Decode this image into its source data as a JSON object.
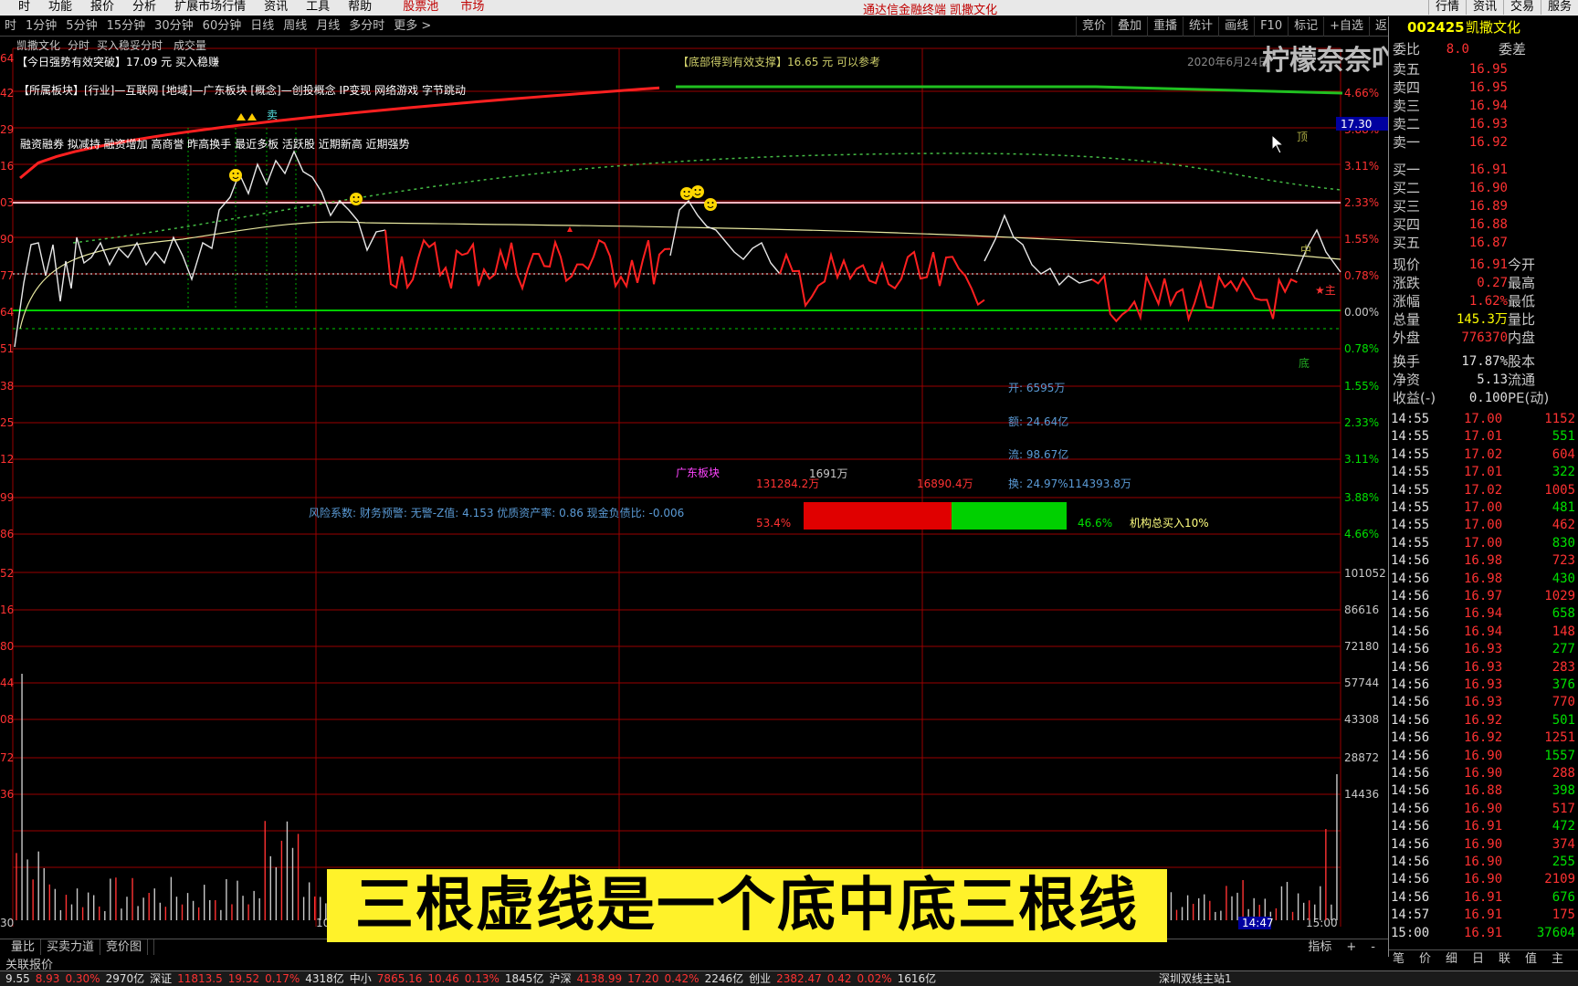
{
  "menu": {
    "items": [
      "时",
      "功能",
      "报价",
      "分析",
      "扩展市场行情",
      "资讯",
      "工具",
      "帮助"
    ],
    "pool": "股票池",
    "market": "市场",
    "center_title": "通达信金融终端  凯撒文化",
    "right": [
      "行情",
      "资讯",
      "交易",
      "服务"
    ]
  },
  "periods": [
    "时",
    "1分钟",
    "5分钟",
    "15分钟",
    "30分钟",
    "60分钟",
    "日线",
    "周线",
    "月线",
    "多分时",
    "更多 >"
  ],
  "toolbar": [
    "竞价",
    "叠加",
    "重播",
    "统计",
    "画线",
    "F10",
    "标记",
    "+自选",
    "返回"
  ],
  "chart_header": {
    "name": "凯撒文化",
    "mode": "分时",
    "buy_text": "买入稳妥分时",
    "vol_label": "成交量"
  },
  "annotations": {
    "strong_break": "【今日强势有效突破】17.09 元 买入稳赚",
    "bottom_support": "【底部得到有效支撑】16.65 元 可以参考",
    "date_text": "2020年6月24日",
    "sector": "【所属板块】[行业]—互联网 [地域]—广东板块 [概念]—创投概念 IP变现 网络游戏 字节跳动",
    "tags": "融资融券 拟减持 融资增加 高商誉 昨高换手 最近多板 活跃股 近期新高 近期强势",
    "top_mark": "顶",
    "mid_mark": "中",
    "bottom_mark": "底",
    "sell_mark": "卖",
    "main_mark": "★主",
    "price_marker": "17.30",
    "risk": "风险系数: 财务预警: 无警-Z值: 4.153 优质资产率: 0.86 现金负债比: -0.006",
    "sector_label": "广东板块",
    "open_amt": "开: 6595万",
    "amount": "额: 24.64亿",
    "flow": "流: 98.67亿",
    "turnover": "换: 24.97%114393.8万",
    "buy_amt": "131284.2万",
    "vol_mid": "1691万",
    "sell_amt": "16890.4万",
    "buy_pct": "53.4%",
    "sell_pct": "46.6%",
    "inst": "机构总买入10%",
    "watermark": "柠檬奈奈吖",
    "time_cursor": "14:47"
  },
  "axis": {
    "left_price": [
      "64",
      "42",
      "29",
      "16",
      "03",
      "90",
      "77",
      "64",
      "51",
      "38",
      "25",
      "12",
      "99",
      "86"
    ],
    "right_pct": [
      "4.66%",
      "3.88%",
      "3.11%",
      "2.33%",
      "1.55%",
      "0.78%",
      "0.00%",
      "0.78%",
      "1.55%",
      "2.33%",
      "3.11%",
      "3.88%",
      "4.66%"
    ],
    "left_vol": [
      "52",
      "16",
      "80",
      "44",
      "08",
      "72",
      "36"
    ],
    "right_vol": [
      "101052",
      "86616",
      "72180",
      "57744",
      "43308",
      "28872",
      "14436"
    ],
    "x_start": "30",
    "x_mid": "10",
    "x_end": "15:00"
  },
  "quote": {
    "code": "002425",
    "name": "凯撒文化",
    "weibi_label": "委比",
    "weibi": "8.0",
    "weicha_label": "委差",
    "asks": [
      {
        "label": "卖五",
        "price": "16.95"
      },
      {
        "label": "卖四",
        "price": "16.95"
      },
      {
        "label": "卖三",
        "price": "16.94"
      },
      {
        "label": "卖二",
        "price": "16.93"
      },
      {
        "label": "卖一",
        "price": "16.92"
      }
    ],
    "bids": [
      {
        "label": "买一",
        "price": "16.91"
      },
      {
        "label": "买二",
        "price": "16.90"
      },
      {
        "label": "买三",
        "price": "16.89"
      },
      {
        "label": "买四",
        "price": "16.88"
      },
      {
        "label": "买五",
        "price": "16.87"
      }
    ],
    "stats": [
      {
        "label": "现价",
        "value": "16.91",
        "label2": "今开",
        "color": "red"
      },
      {
        "label": "涨跌",
        "value": "0.27",
        "label2": "最高",
        "color": "red"
      },
      {
        "label": "涨幅",
        "value": "1.62%",
        "label2": "最低",
        "color": "red"
      },
      {
        "label": "总量",
        "value": "145.3万",
        "label2": "量比",
        "color": "yel"
      },
      {
        "label": "外盘",
        "value": "776370",
        "label2": "内盘",
        "color": "red"
      }
    ],
    "stats2": [
      {
        "label": "换手",
        "value": "17.87%",
        "label2": "股本"
      },
      {
        "label": "净资",
        "value": "5.13",
        "label2": "流通"
      },
      {
        "label": "收益(-)",
        "value": "0.100",
        "label2": "PE(动)"
      }
    ],
    "ticks": [
      {
        "t": "14:55",
        "p": "17.00",
        "v": "1152"
      },
      {
        "t": "14:55",
        "p": "17.01",
        "v": "551"
      },
      {
        "t": "14:55",
        "p": "17.02",
        "v": "604"
      },
      {
        "t": "14:55",
        "p": "17.01",
        "v": "322"
      },
      {
        "t": "14:55",
        "p": "17.02",
        "v": "1005"
      },
      {
        "t": "14:55",
        "p": "17.00",
        "v": "481"
      },
      {
        "t": "14:55",
        "p": "17.00",
        "v": "462"
      },
      {
        "t": "14:55",
        "p": "17.00",
        "v": "830"
      },
      {
        "t": "14:56",
        "p": "16.98",
        "v": "723"
      },
      {
        "t": "14:56",
        "p": "16.98",
        "v": "430"
      },
      {
        "t": "14:56",
        "p": "16.97",
        "v": "1029"
      },
      {
        "t": "14:56",
        "p": "16.94",
        "v": "658"
      },
      {
        "t": "14:56",
        "p": "16.94",
        "v": "148"
      },
      {
        "t": "14:56",
        "p": "16.93",
        "v": "277"
      },
      {
        "t": "14:56",
        "p": "16.93",
        "v": "283"
      },
      {
        "t": "14:56",
        "p": "16.93",
        "v": "376"
      },
      {
        "t": "14:56",
        "p": "16.93",
        "v": "770"
      },
      {
        "t": "14:56",
        "p": "16.92",
        "v": "501"
      },
      {
        "t": "14:56",
        "p": "16.92",
        "v": "1251"
      },
      {
        "t": "14:56",
        "p": "16.90",
        "v": "1557"
      },
      {
        "t": "14:56",
        "p": "16.90",
        "v": "288"
      },
      {
        "t": "14:56",
        "p": "16.88",
        "v": "398"
      },
      {
        "t": "14:56",
        "p": "16.90",
        "v": "517"
      },
      {
        "t": "14:56",
        "p": "16.91",
        "v": "472"
      },
      {
        "t": "14:56",
        "p": "16.90",
        "v": "374"
      },
      {
        "t": "14:56",
        "p": "16.90",
        "v": "255"
      },
      {
        "t": "14:56",
        "p": "16.90",
        "v": "2109"
      },
      {
        "t": "14:56",
        "p": "16.91",
        "v": "676"
      },
      {
        "t": "14:57",
        "p": "16.91",
        "v": "175"
      },
      {
        "t": "15:00",
        "p": "16.91",
        "v": "37604"
      }
    ],
    "bottom_tabs": [
      "笔",
      "价",
      "细",
      "日",
      "联",
      "值",
      "主"
    ]
  },
  "bottom_tabs": [
    "量比",
    "买卖力道",
    "竞价图"
  ],
  "bottom_right": [
    "指标",
    "+",
    "-"
  ],
  "linked_quote": "关联报价",
  "status": [
    {
      "text": "9.55",
      "c": "wht"
    },
    {
      "text": "8.93",
      "c": "red"
    },
    {
      "text": "0.30%",
      "c": "red"
    },
    {
      "text": "2970亿",
      "c": "wht"
    },
    {
      "text": "深证",
      "c": "wht"
    },
    {
      "text": "11813.5",
      "c": "red"
    },
    {
      "text": "19.52",
      "c": "red"
    },
    {
      "text": "0.17%",
      "c": "red"
    },
    {
      "text": "4318亿",
      "c": "wht"
    },
    {
      "text": "中小",
      "c": "wht"
    },
    {
      "text": "7865.16",
      "c": "red"
    },
    {
      "text": "10.46",
      "c": "red"
    },
    {
      "text": "0.13%",
      "c": "red"
    },
    {
      "text": "1845亿",
      "c": "wht"
    },
    {
      "text": "沪深",
      "c": "wht"
    },
    {
      "text": "4138.99",
      "c": "red"
    },
    {
      "text": "17.20",
      "c": "red"
    },
    {
      "text": "0.42%",
      "c": "red"
    },
    {
      "text": "2246亿",
      "c": "wht"
    },
    {
      "text": "创业",
      "c": "wht"
    },
    {
      "text": "2382.47",
      "c": "red"
    },
    {
      "text": "0.42",
      "c": "red"
    },
    {
      "text": "0.02%",
      "c": "red"
    },
    {
      "text": "1616亿",
      "c": "wht"
    }
  ],
  "status_server": "深圳双线主站1",
  "subtitle": "三根虚线是一个底中底三根线",
  "colors": {
    "red": "#ff3232",
    "green": "#00e000",
    "yellow": "#ffff00",
    "bg": "#000000",
    "grid": "#8b0000"
  }
}
